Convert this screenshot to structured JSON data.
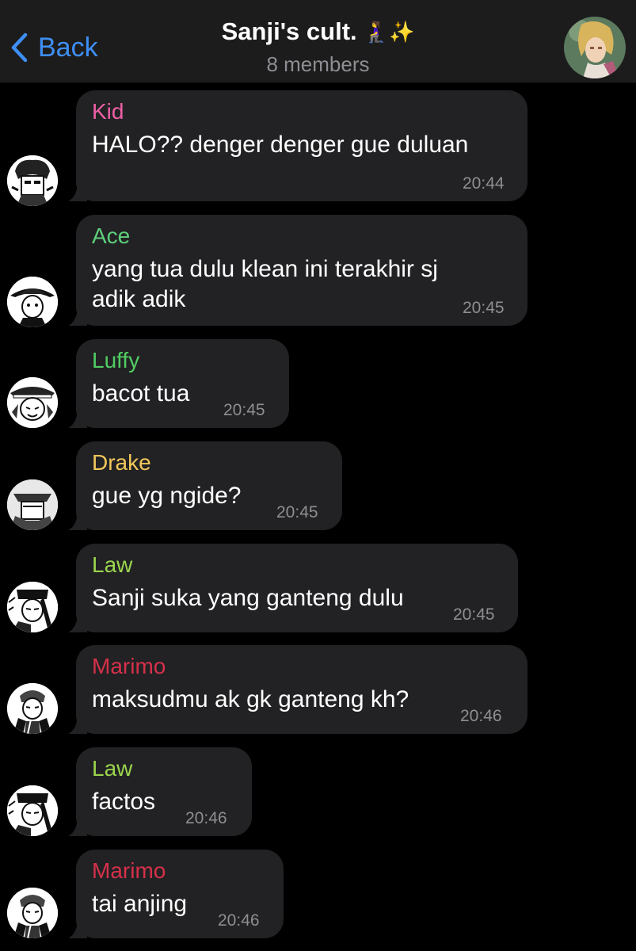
{
  "header": {
    "back_label": "Back",
    "title": "Sanji's cult.",
    "title_emoji": "🧎‍♀️✨",
    "subtitle": "8 members"
  },
  "colors": {
    "accent": "#3e8ff5",
    "kid": "#ee5fa6",
    "ace": "#5ed07a",
    "luffy": "#51cd63",
    "drake": "#f1c75b",
    "law": "#9bd54d",
    "marimo": "#d6304a"
  },
  "messages": [
    {
      "sender": "Kid",
      "lines": [
        "HALO?? denger denger gue duluan"
      ],
      "time": "20:44"
    },
    {
      "sender": "Ace",
      "lines": [
        "yang tua dulu klean ini terakhir sj",
        "adik adik"
      ],
      "time": "20:45"
    },
    {
      "sender": "Luffy",
      "lines": [
        "bacot tua"
      ],
      "time": "20:45"
    },
    {
      "sender": "Drake",
      "lines": [
        "gue yg ngide?"
      ],
      "time": "20:45"
    },
    {
      "sender": "Law",
      "lines": [
        "Sanji suka yang ganteng dulu"
      ],
      "time": "20:45"
    },
    {
      "sender": "Marimo",
      "lines": [
        "maksudmu ak gk ganteng kh?"
      ],
      "time": "20:46"
    },
    {
      "sender": "Law",
      "lines": [
        "factos"
      ],
      "time": "20:46"
    },
    {
      "sender": "Marimo",
      "lines": [
        "tai anjing"
      ],
      "time": "20:46"
    }
  ]
}
